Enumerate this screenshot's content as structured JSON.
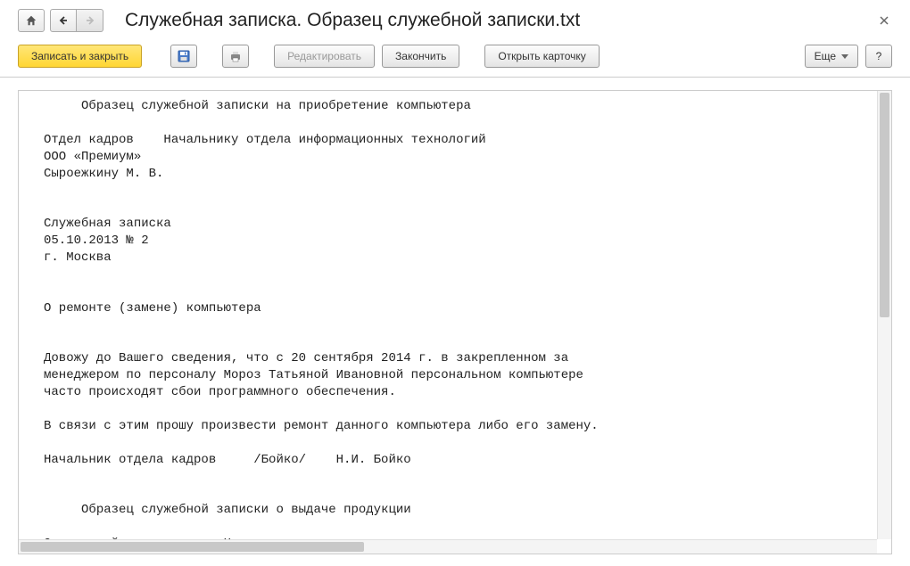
{
  "header": {
    "title": "Служебная записка. Образец служебной записки.txt"
  },
  "toolbar": {
    "save_close": "Записать и закрыть",
    "edit": "Редактировать",
    "finish": "Закончить",
    "open_card": "Открыть карточку",
    "more": "Еще",
    "help": "?"
  },
  "document": {
    "text": "     Образец служебной записки на приобретение компьютера\n\nОтдел кадров    Начальнику отдела информационных технологий\nООО «Премиум»\nСыроежкину М. В.\n\n\nСлужебная записка\n05.10.2013 № 2\nг. Москва\n\n\nО ремонте (замене) компьютера\n\n\nДовожу до Вашего сведения, что с 20 сентября 2014 г. в закрепленном за\nменеджером по персоналу Мороз Татьяной Ивановной персональном компьютере\nчасто происходят сбои программного обеспечения.\n\nВ связи с этим прошу произвести ремонт данного компьютера либо его замену.\n\nНачальник отдела кадров     /Бойко/    Н.И. Бойко\n\n\n     Образец служебной записки о выдаче продукции\n\nОтдел трейд-маркетинга  Начальнику отдела продаж\nООО «Виста»\nБерезе Юлии Семеновне"
  }
}
